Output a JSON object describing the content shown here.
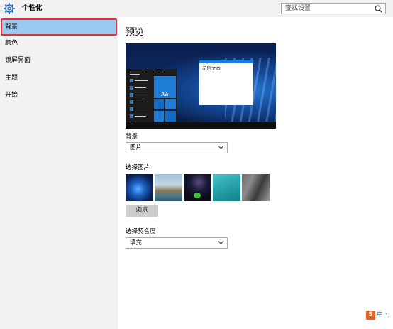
{
  "window": {
    "title": "个性化"
  },
  "search": {
    "placeholder": "查找设置"
  },
  "sidebar": {
    "items": [
      {
        "label": "背景",
        "active": true
      },
      {
        "label": "颜色"
      },
      {
        "label": "锁屏界面"
      },
      {
        "label": "主题"
      },
      {
        "label": "开始"
      }
    ]
  },
  "main": {
    "preview_heading": "预览",
    "preview": {
      "sample_text": "示例文本",
      "tile_label": "Aa"
    },
    "background_label": "背景",
    "background_value": "图片",
    "choose_picture_label": "选择图片",
    "browse_label": "浏览",
    "fit_label": "选择契合度",
    "fit_value": "填充"
  },
  "ime": {
    "logo": "S",
    "mode": "中",
    "punct": "°,"
  },
  "colors": {
    "accent": "#1f7cd6",
    "selected_bg": "#99c9ef",
    "highlight_border": "#e0313a",
    "sidebar_bg": "#f2f2f2"
  }
}
